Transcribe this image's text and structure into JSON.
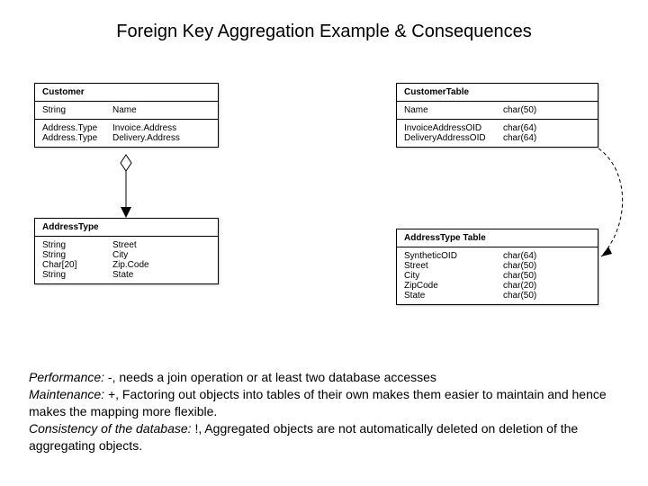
{
  "title": "Foreign Key Aggregation Example & Consequences",
  "customer": {
    "name": "Customer",
    "attr1_type": "String",
    "attr1_name": "Name",
    "attr2_type": "Address.Type",
    "attr2_name": "Invoice.Address",
    "attr3_type": "Address.Type",
    "attr3_name": "Delivery.Address"
  },
  "addressType": {
    "name": "AddressType",
    "attr1_type": "String",
    "attr1_name": "Street",
    "attr2_type": "String",
    "attr2_name": "City",
    "attr3_type": "Char[20]",
    "attr3_name": "Zip.Code",
    "attr4_type": "String",
    "attr4_name": "State"
  },
  "customerTable": {
    "name": "CustomerTable",
    "col1_name": "Name",
    "col1_type": "char(50)",
    "col2_name": "InvoiceAddressOID",
    "col2_type": "char(64)",
    "col3_name": "DeliveryAddressOID",
    "col3_type": "char(64)"
  },
  "addressTable": {
    "name": "AddressType Table",
    "col1_name": "SyntheticOID",
    "col1_type": "char(64)",
    "col2_name": "Street",
    "col2_type": "char(50)",
    "col3_name": "City",
    "col3_type": "char(50)",
    "col4_name": "ZipCode",
    "col4_type": "char(20)",
    "col5_name": "State",
    "col5_type": "char(50)"
  },
  "notes": {
    "perf_label": "Performance:",
    "perf_text": " -, needs a join operation or at least two database accesses",
    "maint_label": "Maintenance:",
    "maint_text": " +,  Factoring out objects  into tables of their own makes them easier to maintain and hence makes the mapping more flexible.",
    "cons_label": "Consistency of the database:",
    "cons_text": " !,  Aggregated objects are not automatically deleted on deletion of the aggregating objects."
  }
}
